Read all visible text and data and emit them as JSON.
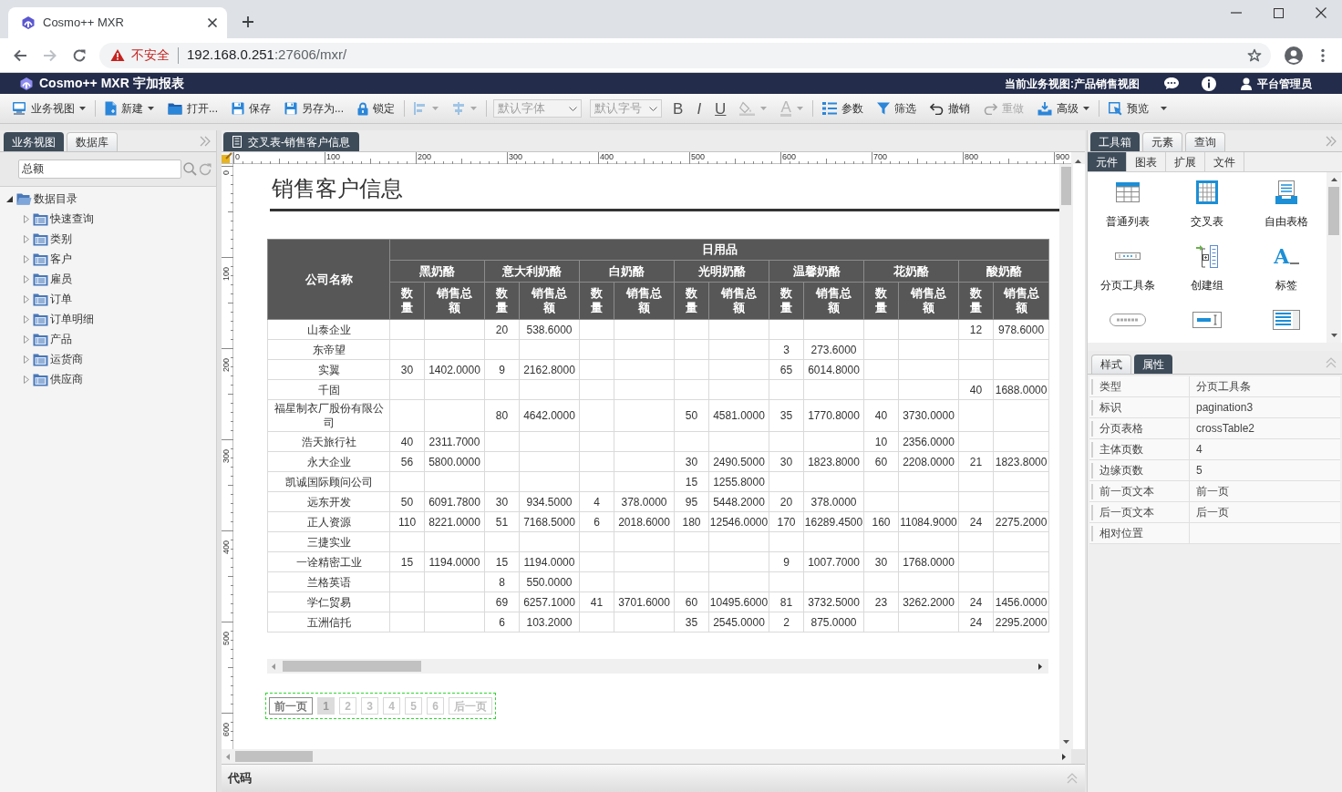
{
  "browser": {
    "tab_title": "Cosmo++ MXR",
    "security_label": "不安全",
    "url_host": "192.168.0.251",
    "url_rest": ":27606/mxr/"
  },
  "app_header": {
    "title": "Cosmo++ MXR 宇加报表",
    "current_view": "当前业务视图:产品销售视图",
    "user": "平台管理员"
  },
  "toolbar": {
    "groups": [
      [
        {
          "kind": "button",
          "label": "业务视图",
          "dropdown": true,
          "disabled": false
        }
      ],
      [
        {
          "kind": "button",
          "label": "新建",
          "dropdown": true,
          "disabled": false
        },
        {
          "kind": "button",
          "label": "打开...",
          "dropdown": false,
          "disabled": false
        },
        {
          "kind": "button",
          "label": "保存",
          "dropdown": false,
          "disabled": false
        },
        {
          "kind": "button",
          "label": "另存为...",
          "dropdown": false,
          "disabled": false
        },
        {
          "kind": "button",
          "label": "锁定",
          "dropdown": false,
          "disabled": false
        }
      ],
      [
        {
          "kind": "icon",
          "dropdown": true,
          "disabled": true
        },
        {
          "kind": "icon",
          "dropdown": true,
          "disabled": true
        }
      ],
      [
        {
          "kind": "select",
          "value": "默认字体",
          "disabled": true
        },
        {
          "kind": "select",
          "value": "默认字号",
          "disabled": true
        },
        {
          "kind": "glyph",
          "label": "B",
          "dropdown": false,
          "disabled": false
        },
        {
          "kind": "glyph",
          "label": "I",
          "dropdown": false,
          "disabled": false
        },
        {
          "kind": "glyph",
          "label": "U",
          "dropdown": false,
          "disabled": false
        },
        {
          "kind": "icon",
          "dropdown": true,
          "disabled": true
        },
        {
          "kind": "glyph",
          "label": "A",
          "dropdown": true,
          "disabled": true
        }
      ],
      [
        {
          "kind": "button",
          "label": "参数",
          "dropdown": false,
          "disabled": false
        },
        {
          "kind": "button",
          "label": "筛选",
          "dropdown": false,
          "disabled": false
        },
        {
          "kind": "button",
          "label": "撤销",
          "dropdown": false,
          "disabled": false
        },
        {
          "kind": "button",
          "label": "重做",
          "dropdown": false,
          "disabled": true
        },
        {
          "kind": "button",
          "label": "高级",
          "dropdown": true,
          "disabled": false
        }
      ],
      [
        {
          "kind": "button",
          "label": "预览",
          "dropdown": true,
          "disabled": false
        }
      ]
    ]
  },
  "left_panel": {
    "tabs": [
      {
        "label": "业务视图",
        "selected": true
      },
      {
        "label": "数据库",
        "selected": false
      }
    ],
    "search": {
      "value": "总额"
    },
    "tree": [
      {
        "label": "数据目录",
        "expanded": true,
        "children": [
          {
            "label": "快速查询",
            "expanded": false
          },
          {
            "label": "类别",
            "expanded": false
          },
          {
            "label": "客户",
            "expanded": false
          },
          {
            "label": "雇员",
            "expanded": false
          },
          {
            "label": "订单",
            "expanded": false
          },
          {
            "label": "订单明细",
            "expanded": false
          },
          {
            "label": "产品",
            "expanded": false
          },
          {
            "label": "运货商",
            "expanded": false
          },
          {
            "label": "供应商",
            "expanded": false
          }
        ]
      }
    ]
  },
  "editor": {
    "tabs": [
      {
        "label": "交叉表-销售客户信息",
        "selected": true
      }
    ],
    "rulers": {
      "horizontal": [
        "0",
        "100",
        "200",
        "300",
        "400",
        "500",
        "600",
        "700",
        "800",
        "900"
      ],
      "vertical": [
        "0",
        "100",
        "200",
        "300",
        "400",
        "500",
        "600"
      ]
    },
    "report": {
      "title": "销售客户信息",
      "table": {
        "corner": "公司名称",
        "group": "日用品",
        "products": [
          {
            "name": "黑奶酪",
            "measures": [
              "数量",
              "销售总额"
            ]
          },
          {
            "name": "意大利奶酪",
            "measures": [
              "数量",
              "销售总额"
            ]
          },
          {
            "name": "白奶酪",
            "measures": [
              "数量",
              "销售总额"
            ]
          },
          {
            "name": "光明奶酪",
            "measures": [
              "数量",
              "销售总额"
            ]
          },
          {
            "name": "温馨奶酪",
            "measures": [
              "数量",
              "销售总额"
            ]
          },
          {
            "name": "花奶酪",
            "measures": [
              "数量",
              "销售总额"
            ]
          },
          {
            "name": "酸奶酪",
            "measures": [
              "数量",
              "销售总额"
            ]
          }
        ],
        "rows": [
          {
            "company": "山泰企业",
            "product_2": {
              "qty": "20",
              "amount": "538.6000"
            },
            "product_7": {
              "qty": "12",
              "amount": "978.6000"
            }
          },
          {
            "company": "东帝望",
            "product_5": {
              "qty": "3",
              "amount": "273.6000"
            }
          },
          {
            "company": "实翼",
            "product_1": {
              "qty": "30",
              "amount": "1402.0000"
            },
            "product_2": {
              "qty": "9",
              "amount": "2162.8000"
            },
            "product_5": {
              "qty": "65",
              "amount": "6014.8000"
            }
          },
          {
            "company": "千固",
            "product_7": {
              "qty": "40",
              "amount": "1688.0000"
            }
          },
          {
            "company": "福星制衣厂股份有限公司",
            "product_2": {
              "qty": "80",
              "amount": "4642.0000"
            },
            "product_4": {
              "qty": "50",
              "amount": "4581.0000"
            },
            "product_5": {
              "qty": "35",
              "amount": "1770.8000"
            },
            "product_6": {
              "qty": "40",
              "amount": "3730.0000"
            }
          },
          {
            "company": "浩天旅行社",
            "product_1": {
              "qty": "40",
              "amount": "2311.7000"
            },
            "product_6": {
              "qty": "10",
              "amount": "2356.0000"
            }
          },
          {
            "company": "永大企业",
            "product_1": {
              "qty": "56",
              "amount": "5800.0000"
            },
            "product_4": {
              "qty": "30",
              "amount": "2490.5000"
            },
            "product_5": {
              "qty": "30",
              "amount": "1823.8000"
            },
            "product_6": {
              "qty": "60",
              "amount": "2208.0000"
            },
            "product_7": {
              "qty": "21",
              "amount": "1823.8000"
            }
          },
          {
            "company": "凯诚国际顾问公司",
            "product_4": {
              "qty": "15",
              "amount": "1255.8000"
            }
          },
          {
            "company": "远东开发",
            "product_1": {
              "qty": "50",
              "amount": "6091.7800"
            },
            "product_2": {
              "qty": "30",
              "amount": "934.5000"
            },
            "product_3": {
              "qty": "4",
              "amount": "378.0000"
            },
            "product_4": {
              "qty": "95",
              "amount": "5448.2000"
            },
            "product_5": {
              "qty": "20",
              "amount": "378.0000"
            }
          },
          {
            "company": "正人资源",
            "product_1": {
              "qty": "110",
              "amount": "8221.0000"
            },
            "product_2": {
              "qty": "51",
              "amount": "7168.5000"
            },
            "product_3": {
              "qty": "6",
              "amount": "2018.6000"
            },
            "product_4": {
              "qty": "180",
              "amount": "12546.0000"
            },
            "product_5": {
              "qty": "170",
              "amount": "16289.4500"
            },
            "product_6": {
              "qty": "160",
              "amount": "11084.9000"
            },
            "product_7": {
              "qty": "24",
              "amount": "2275.2000"
            }
          },
          {
            "company": "三捷实业"
          },
          {
            "company": "一诠精密工业",
            "product_1": {
              "qty": "15",
              "amount": "1194.0000"
            },
            "product_2": {
              "qty": "15",
              "amount": "1194.0000"
            },
            "product_5": {
              "qty": "9",
              "amount": "1007.7000"
            },
            "product_6": {
              "qty": "30",
              "amount": "1768.0000"
            }
          },
          {
            "company": "兰格英语",
            "product_2": {
              "qty": "8",
              "amount": "550.0000"
            }
          },
          {
            "company": "学仁贸易",
            "product_2": {
              "qty": "69",
              "amount": "6257.1000"
            },
            "product_3": {
              "qty": "41",
              "amount": "3701.6000"
            },
            "product_4": {
              "qty": "60",
              "amount": "10495.6000"
            },
            "product_5": {
              "qty": "81",
              "amount": "3732.5000"
            },
            "product_6": {
              "qty": "23",
              "amount": "3262.2000"
            },
            "product_7": {
              "qty": "24",
              "amount": "1456.0000"
            }
          },
          {
            "company": "五洲信托",
            "product_2": {
              "qty": "6",
              "amount": "103.2000"
            },
            "product_4": {
              "qty": "35",
              "amount": "2545.0000"
            },
            "product_5": {
              "qty": "2",
              "amount": "875.0000"
            },
            "product_7": {
              "qty": "24",
              "amount": "2295.2000"
            }
          }
        ]
      },
      "pagination": {
        "previous": "前一页",
        "pages": [
          {
            "label": "1",
            "selected": true
          },
          {
            "label": "2",
            "selected": false
          },
          {
            "label": "3",
            "selected": false
          },
          {
            "label": "4",
            "selected": false
          },
          {
            "label": "5",
            "selected": false
          },
          {
            "label": "6",
            "selected": false
          }
        ],
        "next": "后一页"
      }
    },
    "code_panel": {
      "title": "代码"
    }
  },
  "right_panel": {
    "tabs": [
      {
        "label": "工具箱",
        "selected": true
      },
      {
        "label": "元素",
        "selected": false
      },
      {
        "label": "查询",
        "selected": false
      }
    ],
    "sub_tabs": [
      {
        "label": "元件",
        "selected": true
      },
      {
        "label": "图表",
        "selected": false
      },
      {
        "label": "扩展",
        "selected": false
      },
      {
        "label": "文件",
        "selected": false
      }
    ],
    "tools": [
      {
        "label": "普通列表"
      },
      {
        "label": "交叉表"
      },
      {
        "label": "自由表格"
      },
      {
        "label": "分页工具条"
      },
      {
        "label": "创建组"
      },
      {
        "label": "标签",
        "glyph": "A"
      }
    ],
    "properties": {
      "tabs": [
        {
          "label": "样式",
          "selected": false
        },
        {
          "label": "属性",
          "selected": true
        }
      ],
      "rows": [
        {
          "name": "类型",
          "value": "分页工具条"
        },
        {
          "name": "标识",
          "value": "pagination3"
        },
        {
          "name": "分页表格",
          "value": "crossTable2"
        },
        {
          "name": "主体页数",
          "value": "4"
        },
        {
          "name": "边缘页数",
          "value": "5"
        },
        {
          "name": "前一页文本",
          "value": "前一页"
        },
        {
          "name": "后一页文本",
          "value": "后一页"
        },
        {
          "name": "相对位置"
        }
      ]
    }
  }
}
